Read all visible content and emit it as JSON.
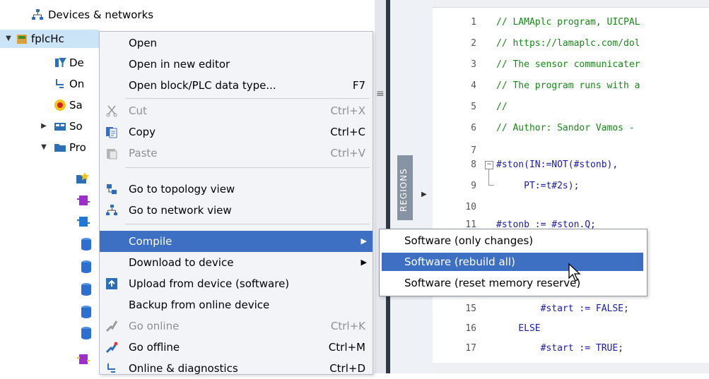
{
  "tree": {
    "header_label": "Devices & networks",
    "nodes": [
      {
        "label": "fplcHc",
        "icon": "plc-device-icon",
        "selected": true
      },
      {
        "label": "De",
        "icon": "device-config-icon"
      },
      {
        "label": "On",
        "icon": "online-diagnostics-icon"
      },
      {
        "label": "Sa",
        "icon": "safety-record-icon"
      },
      {
        "label": "So",
        "icon": "software-units-icon"
      },
      {
        "label": "Pro",
        "icon": "program-blocks-folder-icon"
      }
    ]
  },
  "splitter": {
    "grip": "≡",
    "regions_label": "REGIONS"
  },
  "editor": {
    "lines": [
      {
        "num": "1",
        "text": "// LAMAplc program, UICPAL",
        "kind": "comment"
      },
      {
        "num": "2",
        "text": "// https://lamaplc.com/dol",
        "kind": "comment"
      },
      {
        "num": "3",
        "text": "// The sensor communicater",
        "kind": "comment"
      },
      {
        "num": "4",
        "text": "// The program runs with a",
        "kind": "comment"
      },
      {
        "num": "5",
        "text": "//",
        "kind": "comment"
      },
      {
        "num": "6",
        "text": "// Author: Sandor Vamos -",
        "kind": "comment"
      },
      {
        "num": "7",
        "text": "",
        "kind": "code"
      },
      {
        "num": "8",
        "text": "#ston(IN:=NOT(#stonb),",
        "kind": "code"
      },
      {
        "num": "9",
        "text": "     PT:=t#2s);",
        "kind": "code"
      },
      {
        "num": "10",
        "text": "",
        "kind": "code"
      },
      {
        "num": "11",
        "text": "#stonb := #ston.Q;",
        "kind": "code"
      },
      {
        "num": "15",
        "text": "        #start := FALSE;",
        "kind": "code"
      },
      {
        "num": "16",
        "text": "    ELSE",
        "kind": "code"
      },
      {
        "num": "17",
        "text": "        #start := TRUE;",
        "kind": "code"
      }
    ]
  },
  "context_menu": {
    "items": [
      {
        "label": "Open",
        "shortcut": "",
        "icon": "",
        "disabled": false
      },
      {
        "label": "Open in new editor",
        "shortcut": "",
        "icon": "",
        "disabled": false
      },
      {
        "label": "Open block/PLC data type...",
        "shortcut": "F7",
        "icon": "",
        "disabled": false
      },
      {
        "label": "Cut",
        "shortcut": "Ctrl+X",
        "icon": "scissors-icon",
        "disabled": true
      },
      {
        "label": "Copy",
        "shortcut": "Ctrl+C",
        "icon": "copy-icon",
        "disabled": false
      },
      {
        "label": "Paste",
        "shortcut": "Ctrl+V",
        "icon": "paste-icon",
        "disabled": true
      },
      {
        "label": "Go to topology view",
        "shortcut": "",
        "icon": "topology-icon",
        "disabled": false
      },
      {
        "label": "Go to network view",
        "shortcut": "",
        "icon": "network-icon",
        "disabled": false
      },
      {
        "label": "Compile",
        "shortcut": "",
        "icon": "",
        "disabled": false,
        "submenu": true,
        "highlighted": true
      },
      {
        "label": "Download to device",
        "shortcut": "",
        "icon": "",
        "disabled": false,
        "submenu": true
      },
      {
        "label": "Upload from device (software)",
        "shortcut": "",
        "icon": "upload-icon",
        "disabled": false
      },
      {
        "label": "Backup from online device",
        "shortcut": "",
        "icon": "",
        "disabled": false
      },
      {
        "label": "Go online",
        "shortcut": "Ctrl+K",
        "icon": "go-online-icon",
        "disabled": true
      },
      {
        "label": "Go offline",
        "shortcut": "Ctrl+M",
        "icon": "go-offline-icon",
        "disabled": false
      },
      {
        "label": "Online & diagnostics",
        "shortcut": "Ctrl+D",
        "icon": "diagnostics-icon",
        "disabled": false
      }
    ]
  },
  "compile_submenu": {
    "items": [
      {
        "label": "Software (only changes)",
        "highlighted": false
      },
      {
        "label": "Software (rebuild all)",
        "highlighted": true
      },
      {
        "label": "Software (reset memory reserve)",
        "highlighted": false
      }
    ]
  },
  "colors": {
    "menu_highlight": "#3d6fc2",
    "comment": "#148a14",
    "code": "#1a1aa6",
    "tree_selection": "#cce4f7"
  }
}
